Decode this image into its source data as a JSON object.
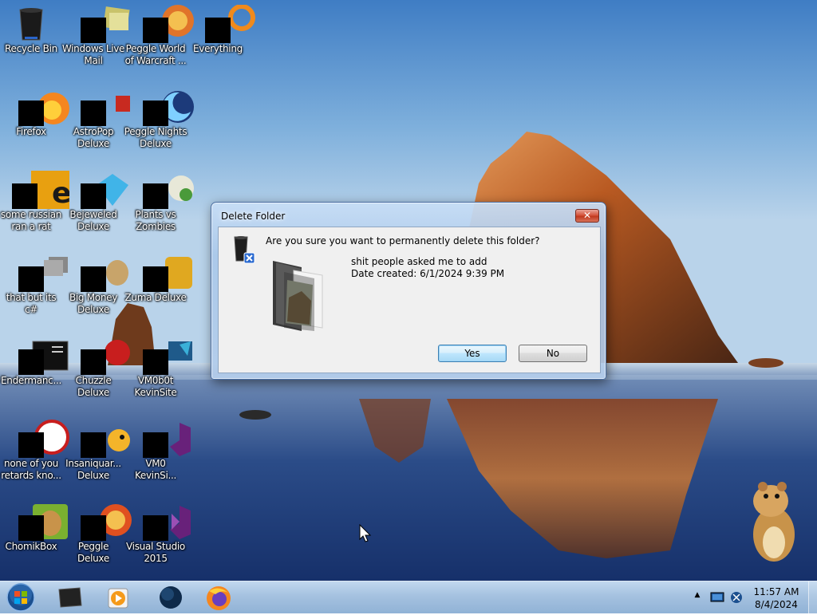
{
  "desktop_icons": [
    {
      "label": "Recycle Bin"
    },
    {
      "label": "Windows Live Mail"
    },
    {
      "label": "Peggle World of Warcraft ..."
    },
    {
      "label": "Everything"
    },
    {
      "label": "Firefox"
    },
    {
      "label": "AstroPop Deluxe"
    },
    {
      "label": "Peggle Nights Deluxe"
    },
    {
      "label": "some russian ran a rat"
    },
    {
      "label": "Bejeweled Deluxe"
    },
    {
      "label": "Plants vs Zombies"
    },
    {
      "label": "that but its c#"
    },
    {
      "label": "Big Money Deluxe"
    },
    {
      "label": "Zuma Deluxe"
    },
    {
      "label": "Endermanc..."
    },
    {
      "label": "Chuzzle Deluxe"
    },
    {
      "label": "VM0b0t KevinSite"
    },
    {
      "label": "none of you retards kno..."
    },
    {
      "label": "Insaniquar... Deluxe"
    },
    {
      "label": "VM0 KevinSi..."
    },
    {
      "label": "ChomikBox"
    },
    {
      "label": "Peggle Deluxe"
    },
    {
      "label": "Visual Studio 2015"
    }
  ],
  "dialog": {
    "title": "Delete Folder",
    "close_glyph": "✕",
    "question": "Are you sure you want to permanently delete this folder?",
    "item_name": "shit people asked me to add",
    "item_date": "Date created: 6/1/2024 9:39 PM",
    "yes_label": "Yes",
    "no_label": "No"
  },
  "taskbar": {
    "pinned": [
      "start-button",
      "windows-explorer",
      "windows-media-player",
      "network-globe",
      "firefox"
    ],
    "tray": {
      "time": "11:57 AM",
      "date": "8/4/2024",
      "show_hidden_glyph": "▲"
    }
  },
  "colors": {
    "sky_top": "#3f7dc4",
    "sea": "#1f3f78",
    "rock": "#c8642a",
    "taskbar": "#a8c4e4",
    "dialog_frame": "#b6d0ee"
  }
}
